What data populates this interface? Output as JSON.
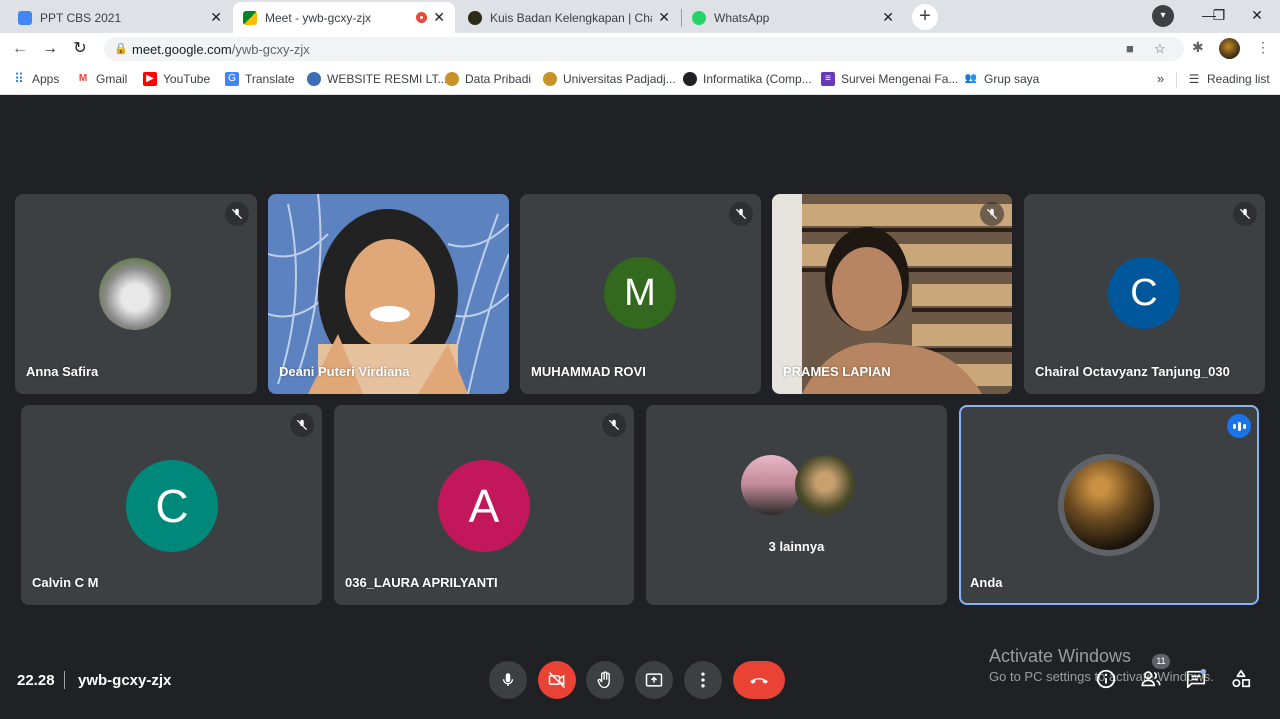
{
  "browser": {
    "tabs": [
      {
        "title": "PPT CBS 2021",
        "favicon": "docs-icon",
        "active": false
      },
      {
        "title": "Meet - ywb-gcxy-zjx",
        "favicon": "meet-icon",
        "active": true,
        "recording": true
      },
      {
        "title": "Kuis Badan Kelengkapan | Charac",
        "favicon": "quiz-icon",
        "active": false
      },
      {
        "title": "WhatsApp",
        "favicon": "whatsapp-icon",
        "active": false
      }
    ],
    "url_host": "meet.google.com",
    "url_path": "/ywb-gcxy-zjx",
    "bookmarks": [
      "Apps",
      "Gmail",
      "YouTube",
      "Translate",
      "WEBSITE RESMI LT...",
      "Data Pribadi",
      "Universitas Padjadj...",
      "Informatika (Comp...",
      "Survei Mengenai Fa...",
      "Grup saya"
    ],
    "reading_list": "Reading list"
  },
  "meet": {
    "participants": [
      {
        "name": "Anna Safira",
        "muted": true,
        "type": "photo-avatar"
      },
      {
        "name": "Deani Puteri Virdiana",
        "muted": false,
        "type": "video"
      },
      {
        "name": "MUHAMMAD ROVI",
        "muted": true,
        "type": "letter",
        "letter": "M",
        "color": "#33691e"
      },
      {
        "name": "PRAMES LAPIAN",
        "muted": true,
        "type": "video"
      },
      {
        "name": "Chairal Octavyanz Tanjung_030",
        "muted": true,
        "type": "letter",
        "letter": "C",
        "color": "#01579b"
      },
      {
        "name": "Calvin C M",
        "muted": true,
        "type": "letter",
        "letter": "C",
        "color": "#00897b"
      },
      {
        "name": "036_LAURA APRILYANTI",
        "muted": true,
        "type": "letter",
        "letter": "A",
        "color": "#c2185b"
      },
      {
        "name": "3 lainnya",
        "muted": false,
        "type": "others"
      },
      {
        "name": "Anda",
        "muted": false,
        "type": "self",
        "speaking": true
      }
    ],
    "time": "22.28",
    "meeting_code": "ywb-gcxy-zjx",
    "people_count": "11"
  },
  "windows": {
    "activate_title": "Activate Windows",
    "activate_sub": "Go to PC settings to activate Windows."
  }
}
